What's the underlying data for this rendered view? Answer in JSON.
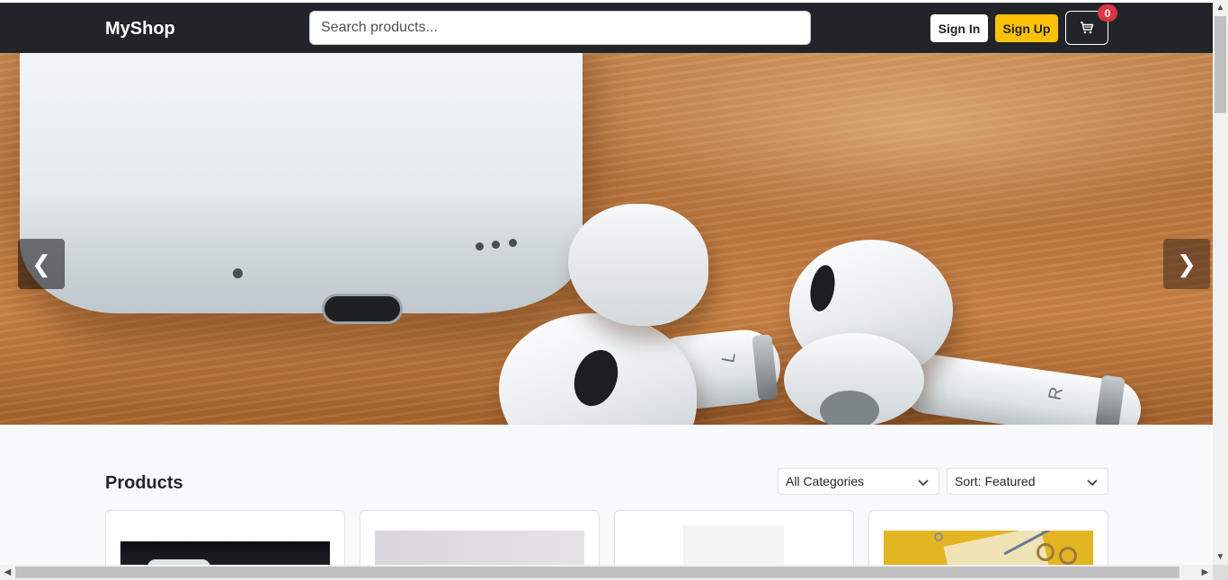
{
  "navbar": {
    "brand": "MyShop",
    "search_placeholder": "Search products...",
    "signin_label": "Sign In",
    "signup_label": "Sign Up",
    "cart_icon": "cart-icon",
    "cart_count": "0",
    "bg_color": "#212529",
    "signup_color": "#ffc107",
    "badge_color": "#dc3545"
  },
  "hero": {
    "image": "wireless-earbuds-with-charging-case",
    "prev_label": "❮",
    "next_label": "❯",
    "bud_left_letter": "L",
    "bud_right_letter": "R"
  },
  "products": {
    "title": "Products",
    "category_filter": {
      "selected": "All Categories"
    },
    "sort": {
      "selected": "Sort: Featured"
    },
    "cards": [
      {
        "image": "earbuds-case-dark-photo"
      },
      {
        "image": "light-gray-product-photo"
      },
      {
        "image": "white-product-photo"
      },
      {
        "image": "office-supplies-on-yellow-photo"
      }
    ]
  }
}
